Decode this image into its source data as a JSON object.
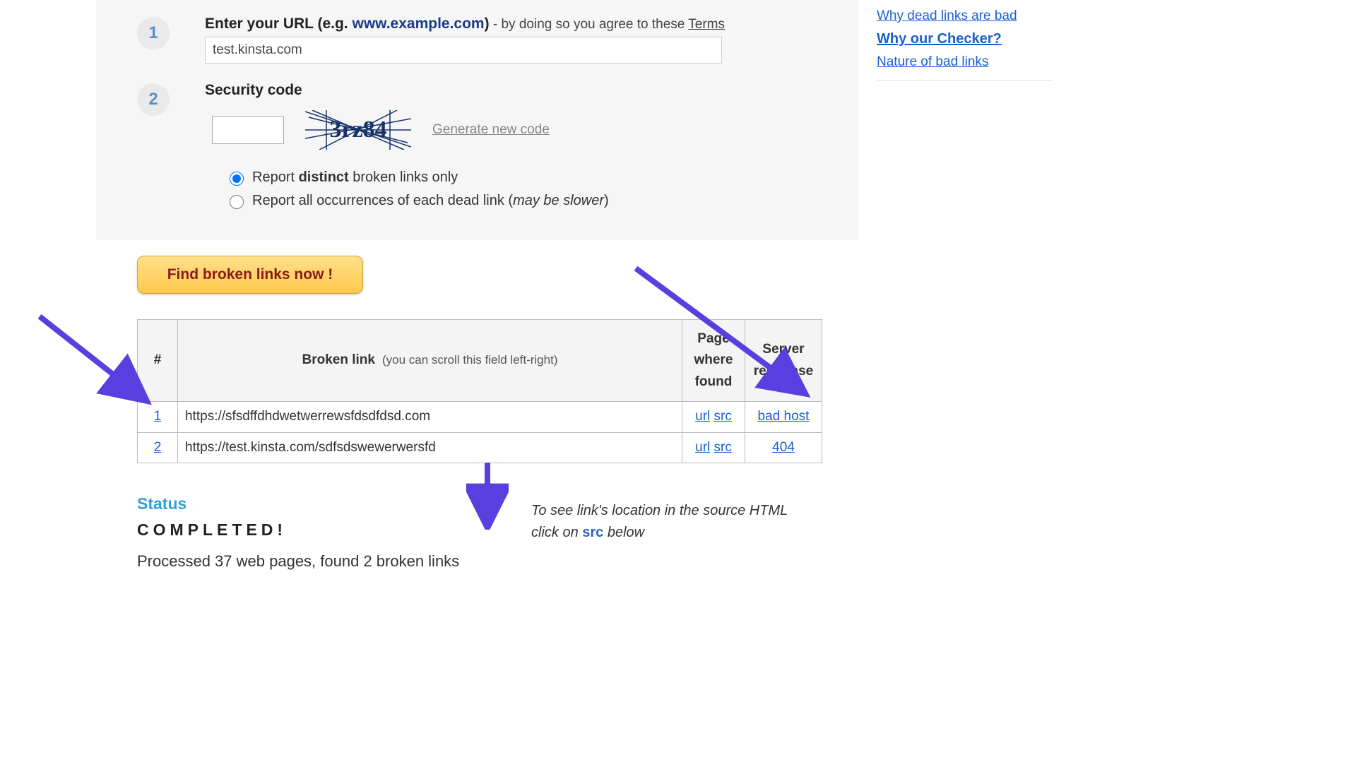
{
  "form": {
    "step1": {
      "num": "1",
      "label_prefix": "Enter your URL (e.g. ",
      "url_example": "www.example.com",
      "label_paren_close": ")",
      "after_dash": " - by doing so you agree to these ",
      "terms": "Terms",
      "url_value": "test.kinsta.com"
    },
    "step2": {
      "num": "2",
      "label": "Security code",
      "captcha_text": "3rz84",
      "generate": "Generate new code",
      "radio_distinct_prefix": "Report ",
      "radio_distinct_bold": "distinct",
      "radio_distinct_suffix": " broken links only",
      "radio_all_prefix": "Report all occurrences of each dead link (",
      "radio_all_italic": "may be slower",
      "radio_all_suffix": ")"
    }
  },
  "results": {
    "button_label": "Find broken links now !",
    "hint_line1": "To see link's location in the source HTML",
    "hint_line2_prefix": "click on ",
    "hint_src": "src",
    "hint_line2_suffix": " below",
    "table": {
      "col_hash": "#",
      "col_broken_main": "Broken link",
      "col_broken_sub": "(you can scroll this field left-right)",
      "col_page_where_found": "Page where found",
      "col_server_response": "Server response",
      "rows": [
        {
          "num": "1",
          "link": "https://sfsdffdhdwetwerrewsfdsdfdsd.com",
          "url": "url",
          "src": "src",
          "resp": "bad host"
        },
        {
          "num": "2",
          "link": "https://test.kinsta.com/sdfsdswewerwersfd",
          "url": "url",
          "src": "src",
          "resp": "404"
        }
      ]
    },
    "status_title": "Status",
    "completed": "COMPLETED!",
    "processed": "Processed 37 web pages, found 2 broken links"
  },
  "sidebar": {
    "links": [
      {
        "text": "Why dead links are bad",
        "active": false
      },
      {
        "text": "Why our Checker?",
        "active": true
      },
      {
        "text": "Nature of bad links",
        "active": false
      }
    ]
  }
}
